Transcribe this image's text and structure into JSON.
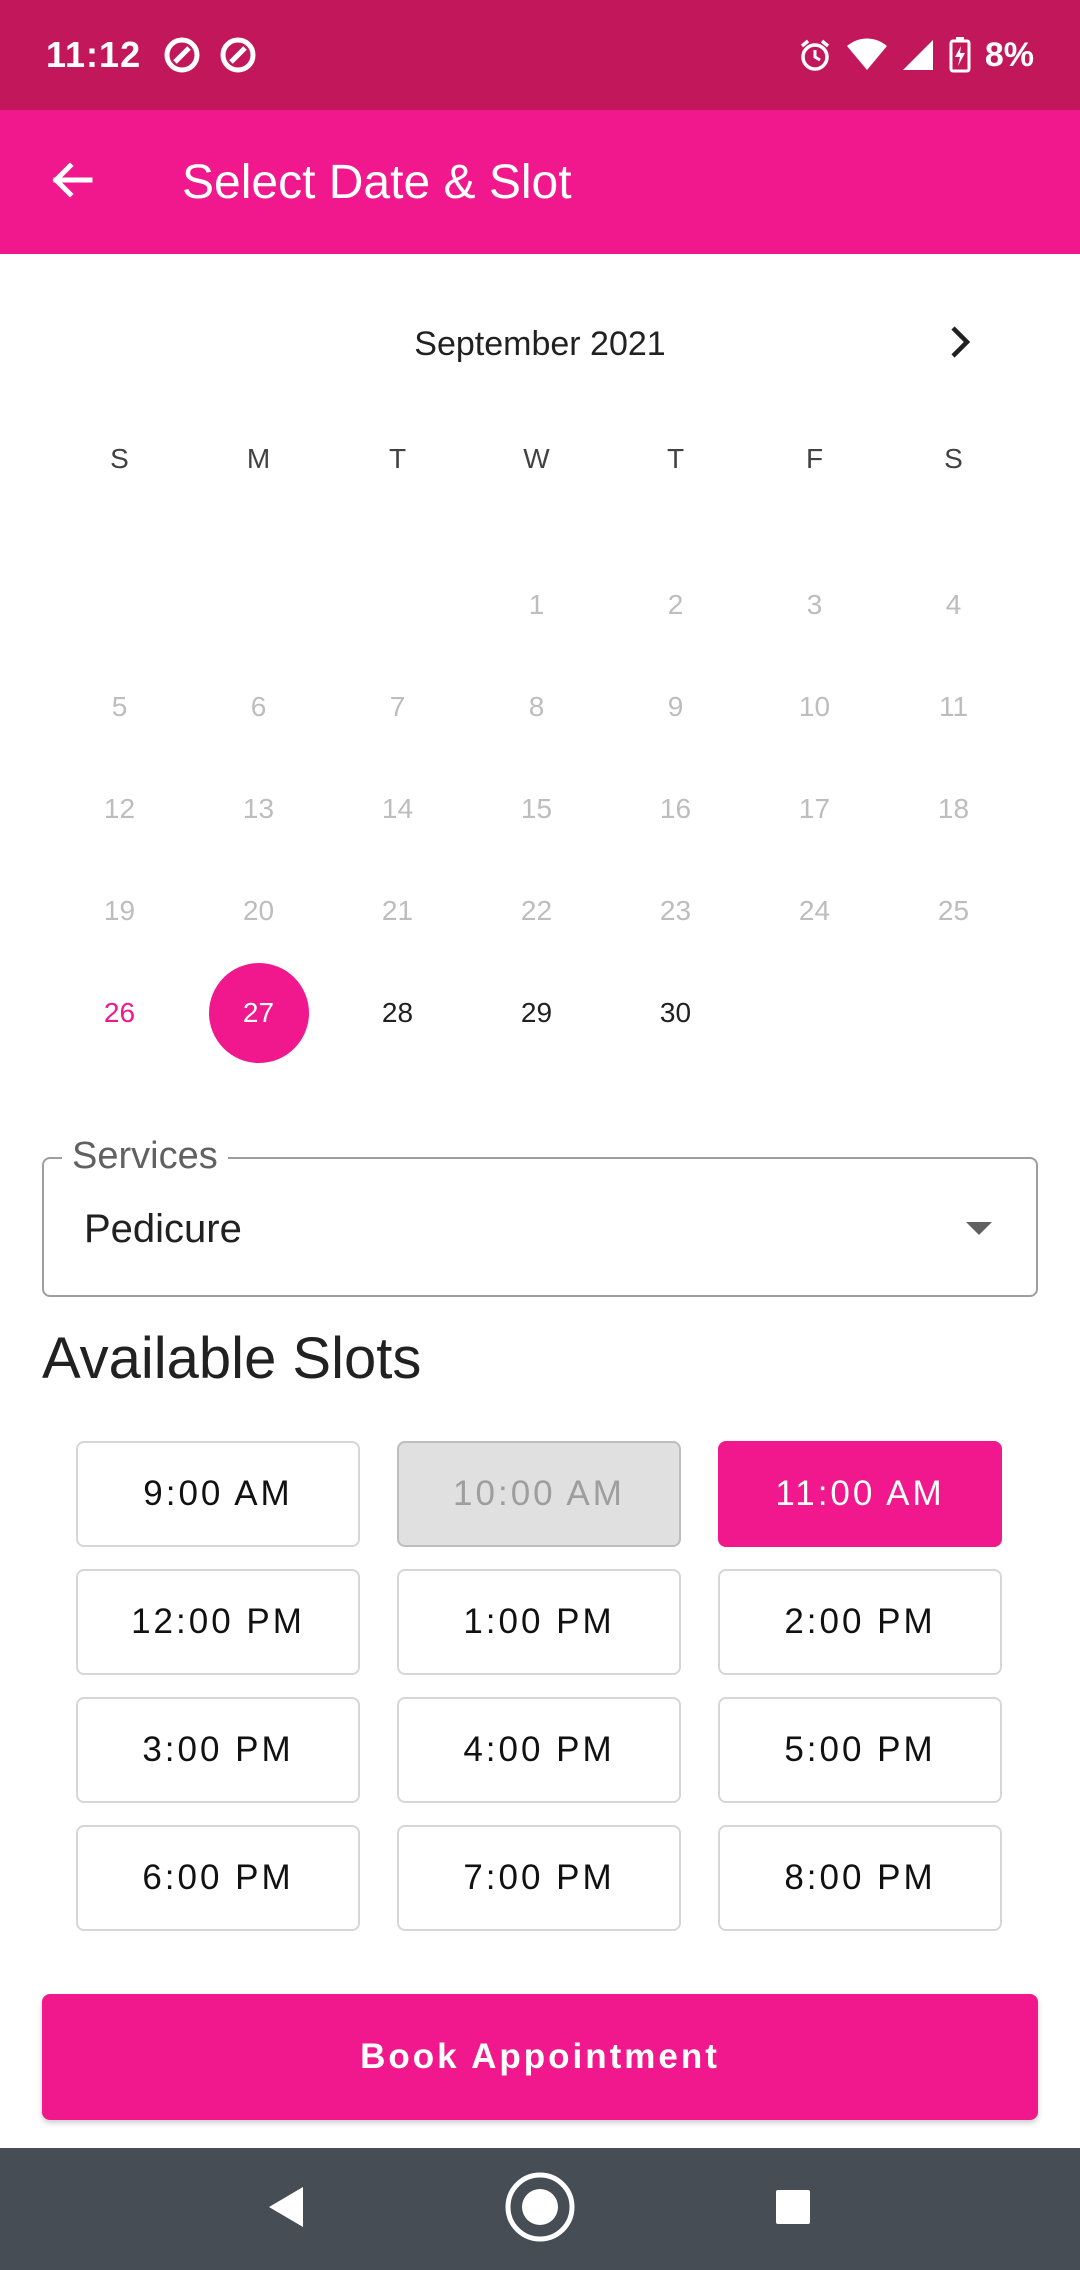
{
  "status_bar": {
    "time": "11:12",
    "battery": "8%",
    "left_icons": [
      "notification-icon",
      "notification-icon"
    ],
    "right_icons": [
      "alarm-icon",
      "wifi-icon",
      "signal-icon",
      "battery-charging-icon"
    ]
  },
  "app_bar": {
    "title": "Select Date & Slot",
    "back_icon": "arrow-back-icon"
  },
  "calendar": {
    "month_label": "September 2021",
    "weekdays": [
      "S",
      "M",
      "T",
      "W",
      "T",
      "F",
      "S"
    ],
    "days": [
      "",
      "",
      "",
      "1",
      "2",
      "3",
      "4",
      "5",
      "6",
      "7",
      "8",
      "9",
      "10",
      "11",
      "12",
      "13",
      "14",
      "15",
      "16",
      "17",
      "18",
      "19",
      "20",
      "21",
      "22",
      "23",
      "24",
      "25",
      "26",
      "27",
      "28",
      "29",
      "30",
      "",
      ""
    ],
    "today": "26",
    "selected": "27",
    "enabled_days": [
      "26",
      "27",
      "28",
      "29",
      "30"
    ]
  },
  "services": {
    "label": "Services",
    "value": "Pedicure"
  },
  "slots": {
    "title": "Available Slots",
    "items": [
      {
        "label": "9:00 AM",
        "state": "available"
      },
      {
        "label": "10:00 AM",
        "state": "disabled"
      },
      {
        "label": "11:00 AM",
        "state": "selected"
      },
      {
        "label": "12:00 PM",
        "state": "available"
      },
      {
        "label": "1:00 PM",
        "state": "available"
      },
      {
        "label": "2:00 PM",
        "state": "available"
      },
      {
        "label": "3:00 PM",
        "state": "available"
      },
      {
        "label": "4:00 PM",
        "state": "available"
      },
      {
        "label": "5:00 PM",
        "state": "available"
      },
      {
        "label": "6:00 PM",
        "state": "available"
      },
      {
        "label": "7:00 PM",
        "state": "available"
      },
      {
        "label": "8:00 PM",
        "state": "available"
      }
    ]
  },
  "book_button": {
    "label": "Book Appointment"
  },
  "colors": {
    "status_bar": "#c2185b",
    "accent": "#f0188c",
    "nav_bar": "#464d55"
  }
}
